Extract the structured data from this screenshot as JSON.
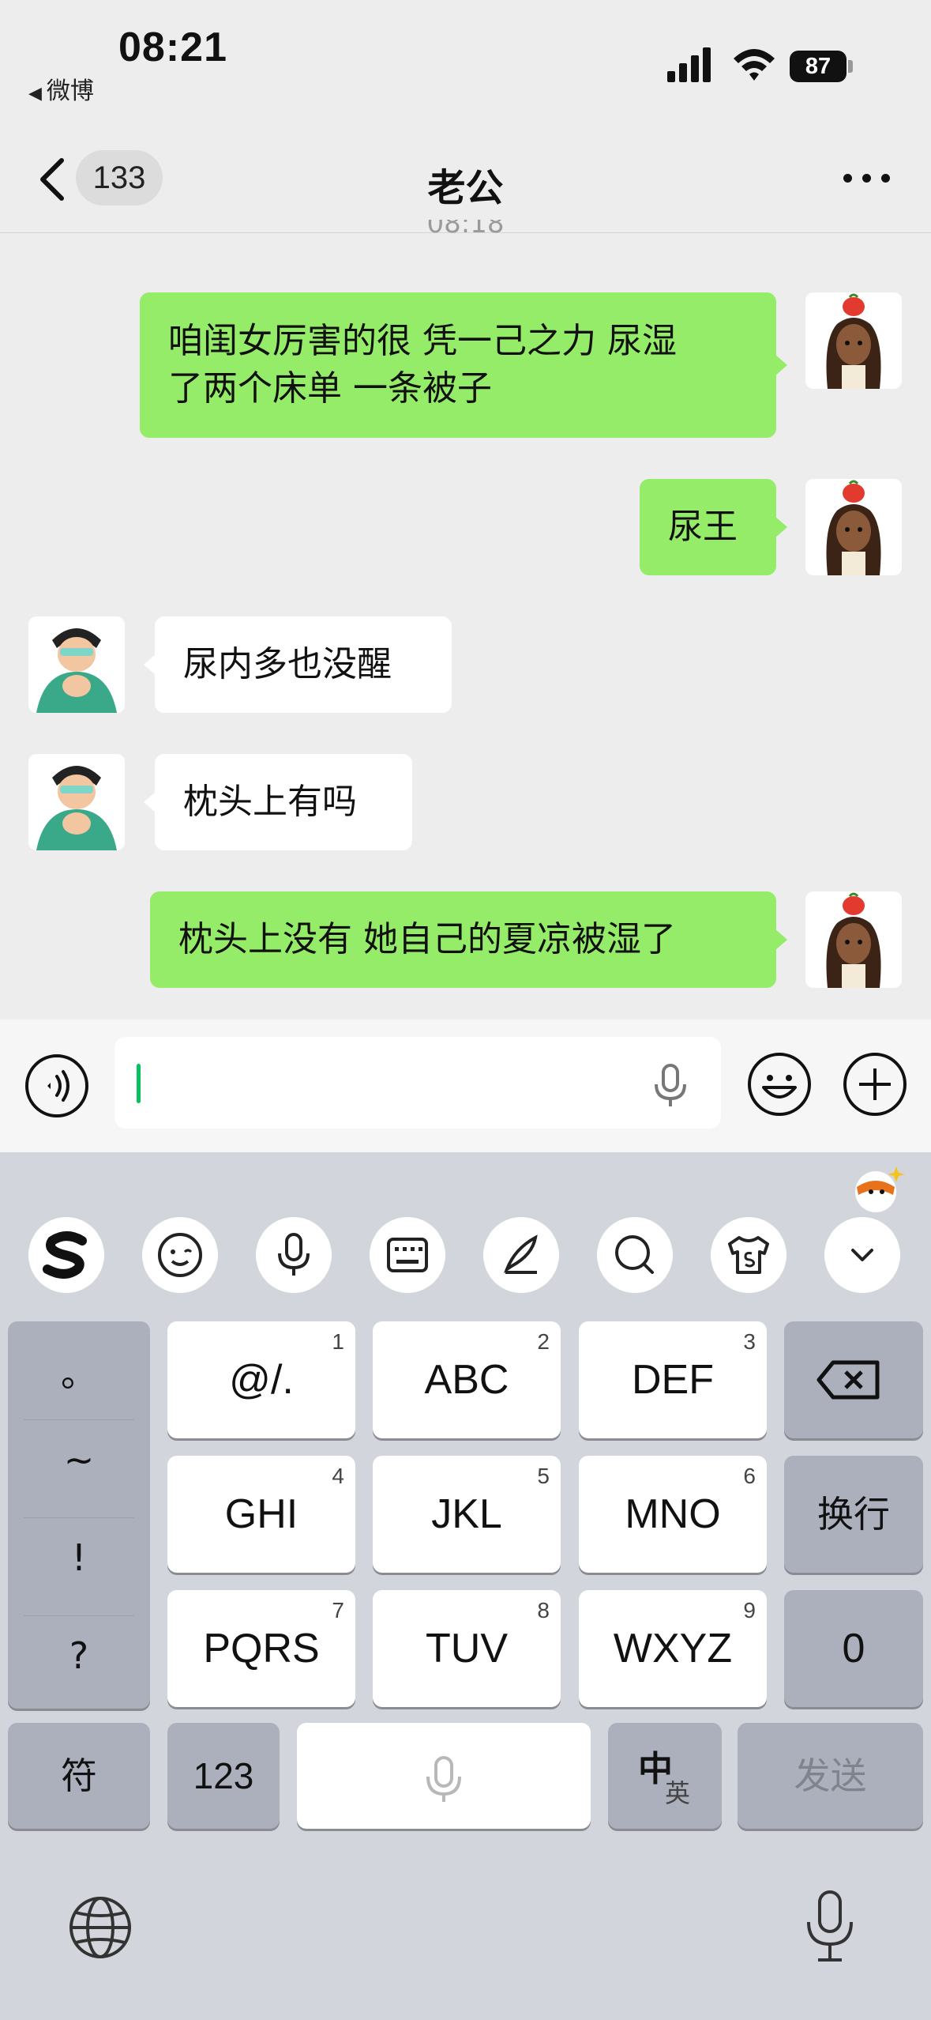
{
  "status_bar": {
    "time": "08:21",
    "back_app": "微博",
    "battery": "87"
  },
  "nav": {
    "back_count": "133",
    "title": "老公"
  },
  "partial_timestamp": "08:18",
  "messages": [
    {
      "sender": "me",
      "text_line1": "咱闺女厉害的很 凭一己之力 尿湿",
      "text_line2": "了两个床单 一条被子"
    },
    {
      "sender": "me",
      "text": "尿王"
    },
    {
      "sender": "other",
      "text": "尿内多也没醒"
    },
    {
      "sender": "other",
      "text": "枕头上有吗"
    },
    {
      "sender": "me",
      "text": "枕头上没有 她自己的夏凉被湿了"
    }
  ],
  "keyboard": {
    "toolbar_icons": [
      "sogou-logo-icon",
      "emoji-face-icon",
      "voice-icon",
      "keyboard-icon",
      "pen-icon",
      "search-icon",
      "tshirt-icon",
      "chevron-down-icon"
    ],
    "symbols": [
      "。",
      "~",
      "!",
      "?"
    ],
    "keys": [
      {
        "label": "@/.",
        "num": "1"
      },
      {
        "label": "ABC",
        "num": "2"
      },
      {
        "label": "DEF",
        "num": "3"
      },
      {
        "label": "GHI",
        "num": "4"
      },
      {
        "label": "JKL",
        "num": "5"
      },
      {
        "label": "MNO",
        "num": "6"
      },
      {
        "label": "PQRS",
        "num": "7"
      },
      {
        "label": "TUV",
        "num": "8"
      },
      {
        "label": "WXYZ",
        "num": "9"
      }
    ],
    "newline": "换行",
    "zero": "0",
    "fu": "符",
    "num123": "123",
    "zh": "中",
    "en": "英",
    "send": "发送"
  }
}
